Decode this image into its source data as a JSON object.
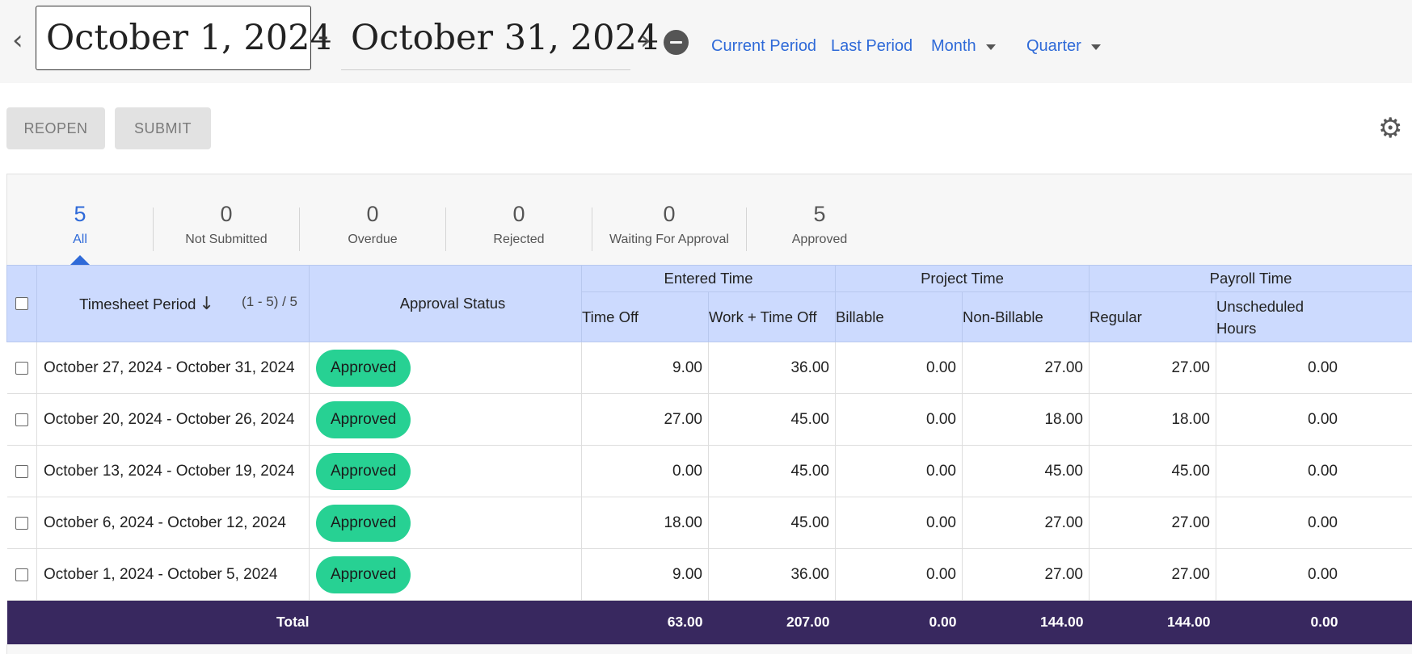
{
  "date_range": {
    "start": "October 1, 2024",
    "separator": "-",
    "end": "October 31, 2024",
    "prev_icon": "chevron-left-icon",
    "next_icon": "chevron-right-icon",
    "clear_icon": "minus-circle-icon"
  },
  "period_links": {
    "current": "Current Period",
    "last": "Last Period",
    "month": "Month",
    "quarter": "Quarter"
  },
  "toolbar": {
    "reopen": "REOPEN",
    "submit": "SUBMIT",
    "settings_icon": "gear-icon"
  },
  "stats": [
    {
      "count": "5",
      "label": "All",
      "active": true
    },
    {
      "count": "0",
      "label": "Not Submitted"
    },
    {
      "count": "0",
      "label": "Overdue"
    },
    {
      "count": "0",
      "label": "Rejected"
    },
    {
      "count": "0",
      "label": "Waiting For Approval"
    },
    {
      "count": "5",
      "label": "Approved"
    }
  ],
  "table": {
    "col_period": "Timesheet Period",
    "range": "(1 - 5) / 5",
    "col_status": "Approval Status",
    "groups": {
      "entered": "Entered Time",
      "project": "Project Time",
      "payroll": "Payroll Time"
    },
    "cols": {
      "time_off": "Time Off",
      "work_time_off": "Work + Time Off",
      "billable": "Billable",
      "non_billable": "Non-Billable",
      "regular": "Regular",
      "unscheduled": "Unscheduled Hours"
    },
    "rows": [
      {
        "period": "October 27, 2024 - October 31, 2024",
        "status": "Approved",
        "time_off": "9.00",
        "work_time_off": "36.00",
        "billable": "0.00",
        "non_billable": "27.00",
        "regular": "27.00",
        "unscheduled": "0.00"
      },
      {
        "period": "October 20, 2024 - October 26, 2024",
        "status": "Approved",
        "time_off": "27.00",
        "work_time_off": "45.00",
        "billable": "0.00",
        "non_billable": "18.00",
        "regular": "18.00",
        "unscheduled": "0.00"
      },
      {
        "period": "October 13, 2024 - October 19, 2024",
        "status": "Approved",
        "time_off": "0.00",
        "work_time_off": "45.00",
        "billable": "0.00",
        "non_billable": "45.00",
        "regular": "45.00",
        "unscheduled": "0.00"
      },
      {
        "period": "October 6, 2024 - October 12, 2024",
        "status": "Approved",
        "time_off": "18.00",
        "work_time_off": "45.00",
        "billable": "0.00",
        "non_billable": "27.00",
        "regular": "27.00",
        "unscheduled": "0.00"
      },
      {
        "period": "October 1, 2024 - October 5, 2024",
        "status": "Approved",
        "time_off": "9.00",
        "work_time_off": "36.00",
        "billable": "0.00",
        "non_billable": "27.00",
        "regular": "27.00",
        "unscheduled": "0.00"
      }
    ],
    "total": {
      "label": "Total",
      "time_off": "63.00",
      "work_time_off": "207.00",
      "billable": "0.00",
      "non_billable": "144.00",
      "regular": "144.00",
      "unscheduled": "0.00"
    }
  },
  "colors": {
    "accent": "#2f6ad8",
    "header_bg": "#ccdafe",
    "approved_badge": "#27d193",
    "total_bg": "#38285f"
  }
}
